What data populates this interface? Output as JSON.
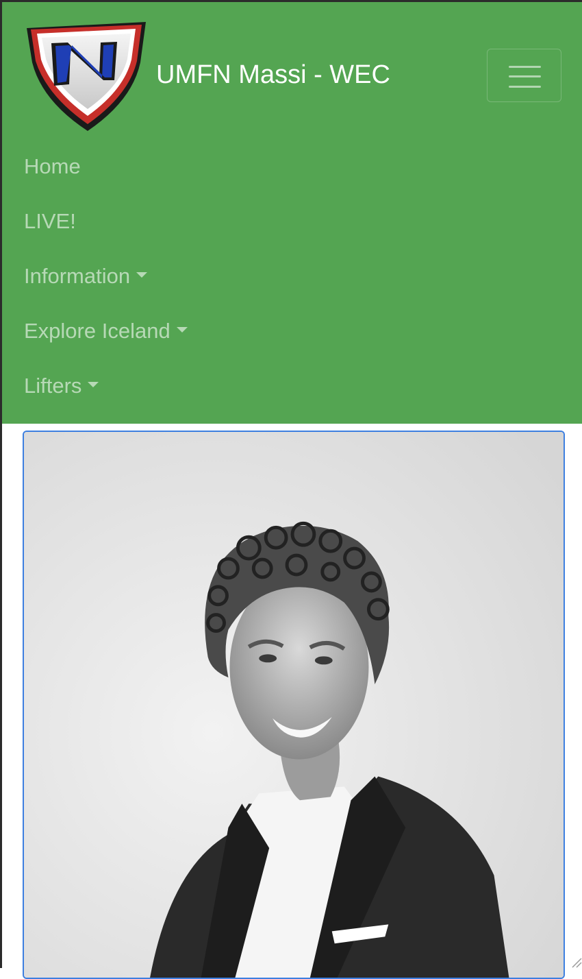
{
  "brand": {
    "title": "UMFN Massi - WEC",
    "logo_letter": "N"
  },
  "navbar": {
    "background": "#54a552",
    "toggler_icon": "hamburger-menu-icon"
  },
  "nav": {
    "items": [
      {
        "label": "Home",
        "dropdown": false
      },
      {
        "label": "LIVE!",
        "dropdown": false
      },
      {
        "label": "Information",
        "dropdown": true
      },
      {
        "label": "Explore Iceland",
        "dropdown": true
      },
      {
        "label": "Lifters",
        "dropdown": true
      }
    ]
  },
  "card": {
    "border_color": "#3d7fe0"
  }
}
